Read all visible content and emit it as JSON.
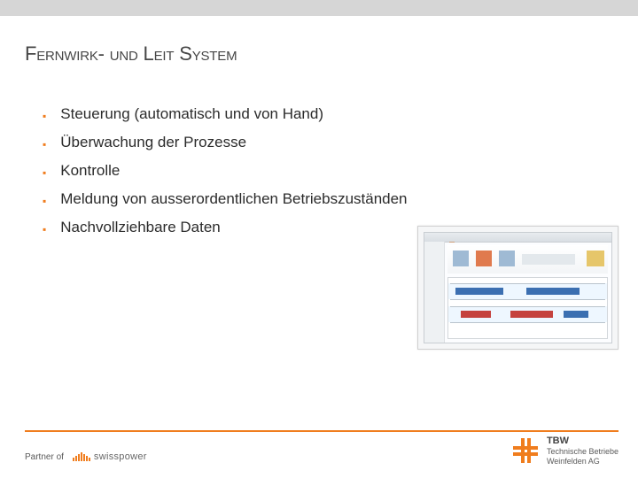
{
  "title_parts": {
    "a": "Fernwirk",
    "dash": "- ",
    "b": "und ",
    "c": "Leit ",
    "d": "System"
  },
  "bullets": [
    "Steuerung (automatisch und von Hand)",
    "Überwachung der Prozesse",
    "Kontrolle",
    "Meldung von ausserordentlichen Betriebszuständen",
    "Nachvollziehbare Daten"
  ],
  "footer": {
    "partner_label": "Partner of",
    "sp_name": "swisspower"
  },
  "tbw": {
    "name": "TBW",
    "line1": "Technische Betriebe",
    "line2": "Weinfelden AG"
  }
}
